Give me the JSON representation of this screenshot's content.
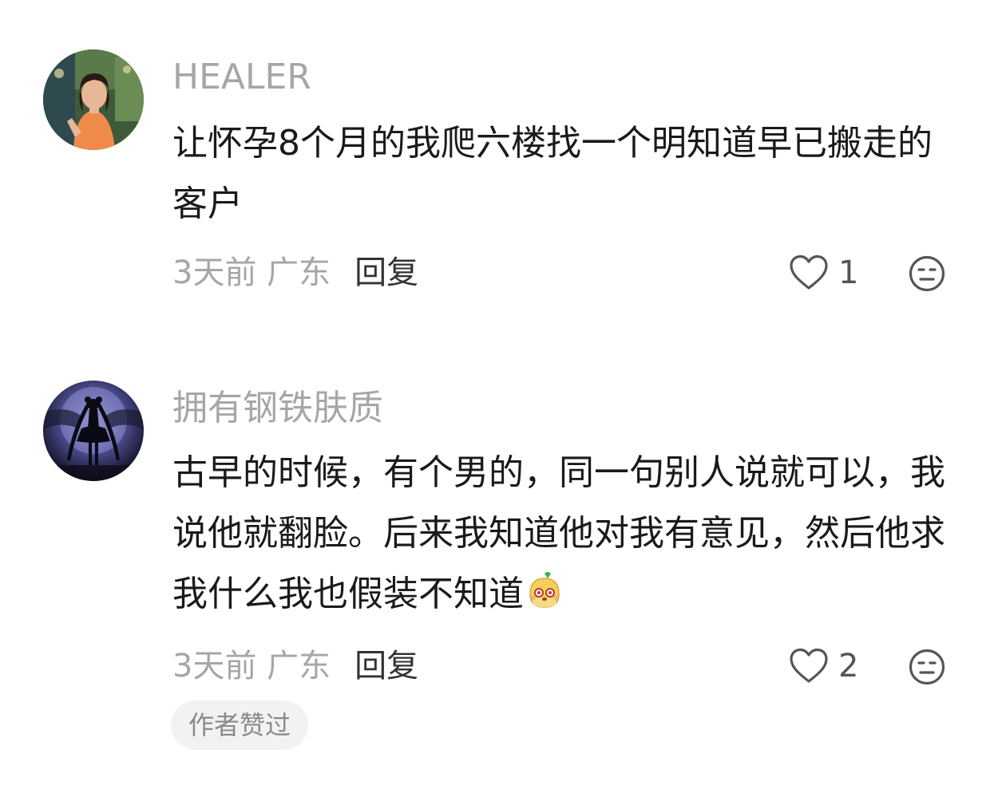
{
  "comments": [
    {
      "username": "HEALER",
      "text": "让怀孕8个月的我爬六楼找一个明知道早已搬走的客户",
      "time_location": "3天前 广东",
      "reply_label": "回复",
      "like_count": "1"
    },
    {
      "username": "拥有钢铁肤质",
      "text": "古早的时候，有个男的，同一句别人说就可以，我说他就翻脸。后来我知道他对我有意见，然后他求我什么我也假装不知道",
      "time_location": "3天前 广东",
      "reply_label": "回复",
      "like_count": "2",
      "badge": "作者赞过"
    }
  ],
  "icons": {
    "like": "heart-outline-icon",
    "dislike": "neutral-face-icon",
    "emoji": "smirk-sticker-emoji"
  }
}
